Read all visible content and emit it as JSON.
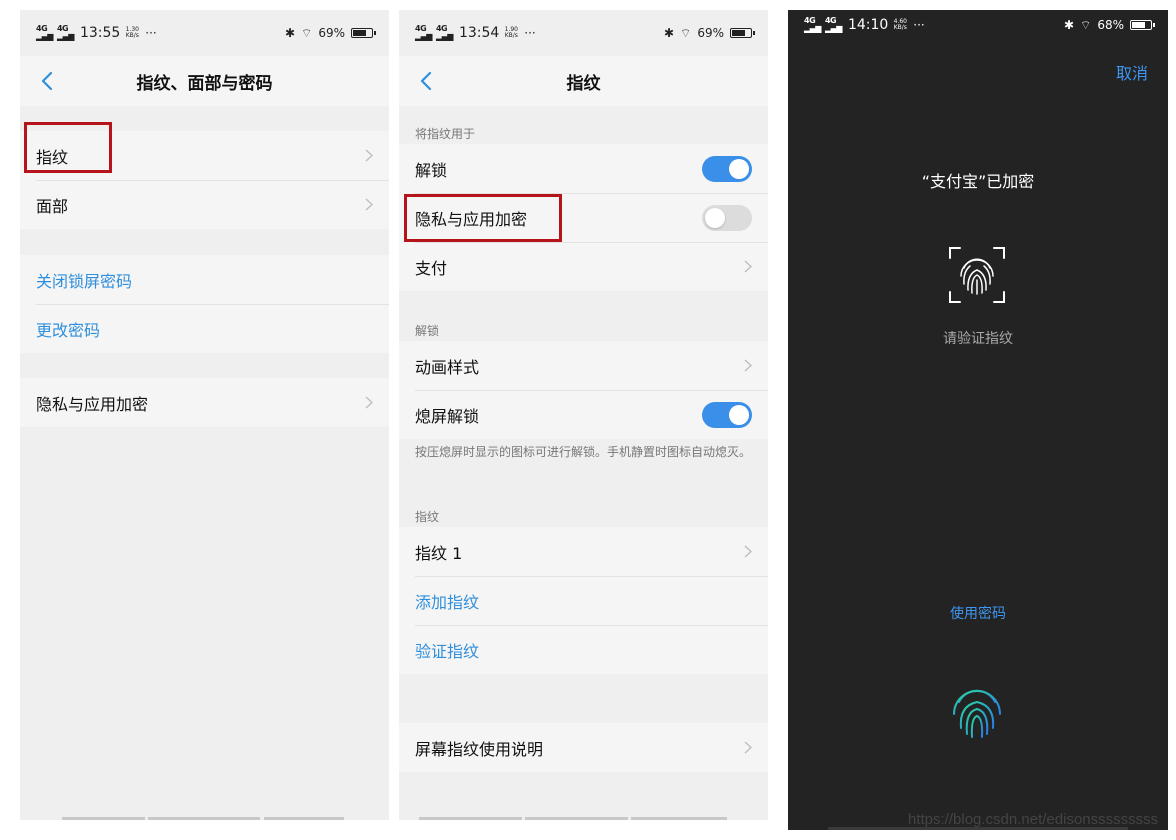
{
  "status1": {
    "network": "4G",
    "time": "13:55",
    "speed": "1.30",
    "speed_unit": "KB/s",
    "more": "···",
    "battery": "69%",
    "battery_level": 0.69
  },
  "status2": {
    "network": "4G",
    "time": "13:54",
    "speed": "1.90",
    "speed_unit": "KB/s",
    "more": "···",
    "battery": "69%",
    "battery_level": 0.69
  },
  "status3": {
    "network": "4G",
    "time": "14:10",
    "speed": "4.60",
    "speed_unit": "KB/s",
    "more": "···",
    "battery": "68%",
    "battery_level": 0.68
  },
  "screen1": {
    "title": "指纹、面部与密码",
    "rows": [
      "指纹",
      "面部"
    ],
    "links": [
      "关闭锁屏密码",
      "更改密码"
    ],
    "privacy": "隐私与应用加密"
  },
  "screen2": {
    "title": "指纹",
    "section_use_for": "将指纹用于",
    "unlock": "解锁",
    "privacy": "隐私与应用加密",
    "payment": "支付",
    "section_unlock": "解锁",
    "animation": "动画样式",
    "screen_off_unlock": "熄屏解锁",
    "note": "按压熄屏时显示的图标可进行解锁。手机静置时图标自动熄灭。",
    "section_fingerprint": "指纹",
    "fingerprint_1": "指纹 1",
    "add_fingerprint": "添加指纹",
    "verify_fingerprint": "验证指纹",
    "instructions": "屏幕指纹使用说明",
    "toggles": {
      "unlock": true,
      "privacy": false,
      "screen_off_unlock": true
    }
  },
  "screen3": {
    "cancel": "取消",
    "title": "“支付宝”已加密",
    "verify": "请验证指纹",
    "use_password": "使用密码"
  },
  "watermark": "https://blog.csdn.net/edisonsssssssss",
  "colors": {
    "accent": "#3a8fe8",
    "link": "#2f8fdc",
    "highlight": "#b5141b",
    "dark_bg": "#232323"
  }
}
